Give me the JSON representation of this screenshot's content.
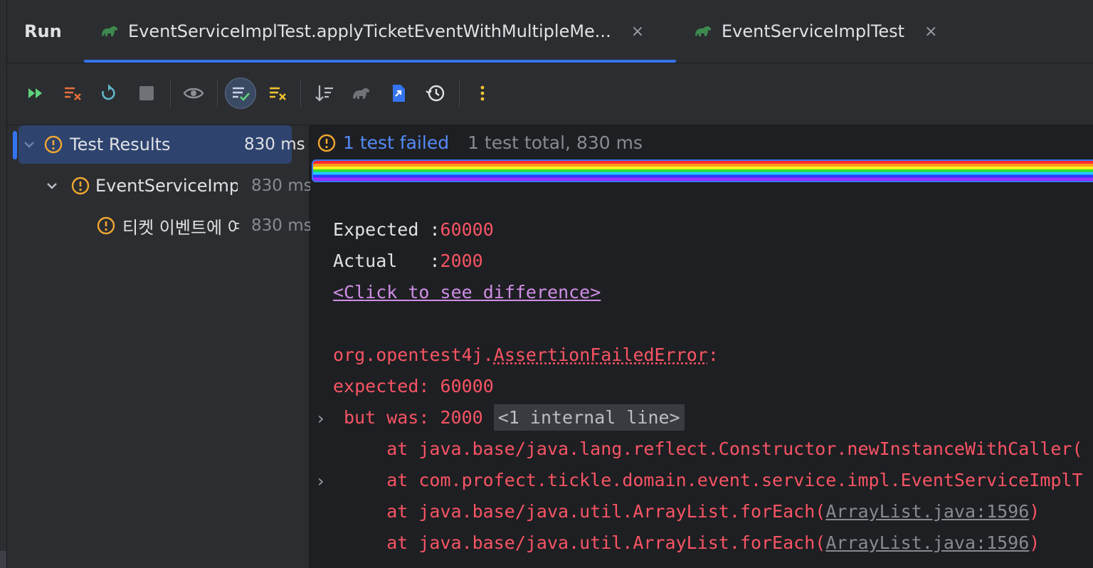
{
  "tool_window": {
    "title": "Run"
  },
  "tabs": [
    {
      "label": "EventServiceImplTest.applyTicketEventWithMultipleMe...",
      "close": "×",
      "active": true
    },
    {
      "label": "EventServiceImplTest",
      "close": "×",
      "active": false
    }
  ],
  "toolbar": {
    "items": [
      "rerun-failed-icon",
      "clear-all-icon",
      "rerun-icon",
      "stop-icon",
      "show-passed-icon",
      "show-ignored-icon",
      "clear-failed-icon",
      "sort-icon",
      "gradle-icon",
      "export-icon",
      "history-icon",
      "more-icon"
    ]
  },
  "tree": {
    "rows": [
      {
        "label": "Test Results",
        "time": "830 ms"
      },
      {
        "label": "EventServiceImpl",
        "time": "830 ms"
      },
      {
        "label": "티켓 이벤트에 여",
        "time": "830 ms"
      }
    ]
  },
  "status": {
    "failed": "1 test failed",
    "summary": "1 test total, 830 ms"
  },
  "output": {
    "expected_label": "Expected :",
    "expected_value": "60000",
    "actual_label": "Actual   :",
    "actual_value": "2000",
    "diff_link": "<Click to see difference>",
    "error_pkg": "org.opentest4j.",
    "error_class": "AssertionFailedError",
    "error_colon": ":",
    "expected_line": "expected: 60000",
    "but_was": "but was: 2000",
    "internal": "<1 internal line>",
    "stack": [
      {
        "prefix": "    at java.base/java.lang.reflect.Constructor.newInstanceWithCaller(",
        "link": "",
        "suffix": ""
      },
      {
        "prefix": "    at com.profect.tickle.domain.event.service.impl.EventServiceImplT",
        "link": "",
        "suffix": ""
      },
      {
        "prefix": "    at java.base/java.util.ArrayList.forEach(",
        "link": "ArrayList.java:1596",
        "suffix": ")"
      },
      {
        "prefix": "    at java.base/java.util.ArrayList.forEach(",
        "link": "ArrayList.java:1596",
        "suffix": ")"
      }
    ]
  },
  "colors": {
    "accent": "#3574f0",
    "error": "#f75464",
    "warn": "#f0a732",
    "link": "#cf8ee6"
  }
}
